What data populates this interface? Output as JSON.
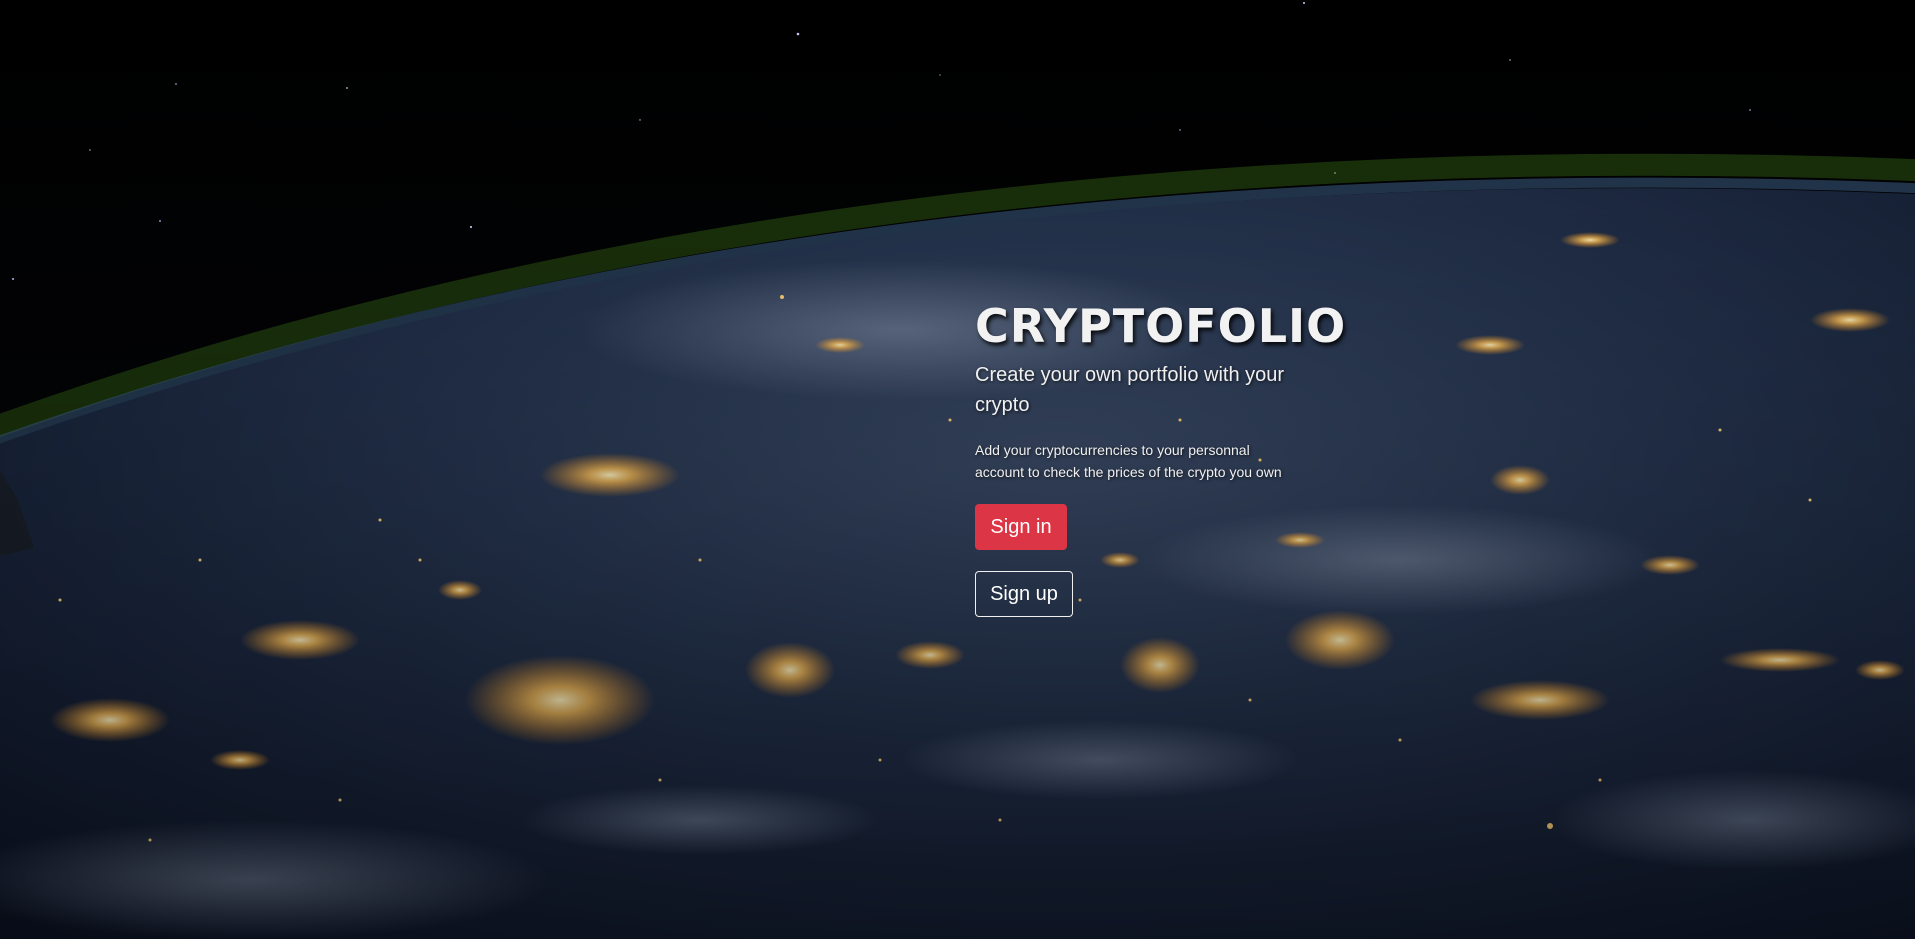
{
  "hero": {
    "title": "CRYPTOFOLIO",
    "tagline": "Create your own portfolio with your crypto",
    "description": "Add your cryptocurrencies to your personnal account to check the prices of the crypto you own",
    "background": "earth-at-night-from-space-image"
  },
  "actions": {
    "signin_label": "Sign in",
    "signup_label": "Sign up"
  },
  "colors": {
    "primary_button": "#dc3545",
    "text": "#f0f0f0",
    "space": "#020306"
  }
}
